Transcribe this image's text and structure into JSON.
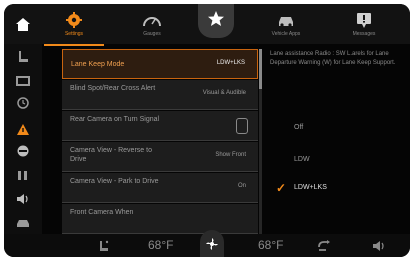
{
  "tabs": [
    {
      "label": "Settings",
      "icon": "gear-icon",
      "active": true
    },
    {
      "label": "Gauges",
      "icon": "gauge-icon",
      "active": false
    },
    {
      "label": "",
      "icon": "star-icon",
      "active": false
    },
    {
      "label": "Vehicle Apps",
      "icon": "car-icon",
      "active": false
    },
    {
      "label": "Messages",
      "icon": "message-icon",
      "active": false
    }
  ],
  "rail": [
    "seat-icon",
    "display-icon",
    "clock-icon",
    "warning-icon",
    "safety-icon",
    "seat-heat-icon",
    "audio-icon",
    "vehicle-icon"
  ],
  "settings": [
    {
      "title": "Lane Keep Mode",
      "value": "LDW+LKS",
      "selected": true
    },
    {
      "title": "Blind Spot/Rear Cross Alert",
      "value": "Visual & Audible",
      "selected": false
    },
    {
      "title": "Rear Camera on Turn Signal",
      "value": "",
      "selected": false,
      "toggle": true
    },
    {
      "title": "Camera View - Reverse to Drive",
      "value": "Show Front",
      "selected": false
    },
    {
      "title": "Camera View - Park to Drive",
      "value": "On",
      "selected": false
    },
    {
      "title": "Front Camera When",
      "value": "",
      "selected": false
    }
  ],
  "info_text": "Lane assistance Radio : SW L.arels for Lane Departure Warning (W) for Lane Keep Support.",
  "options": [
    {
      "label": "Off",
      "checked": false
    },
    {
      "label": "LDW",
      "checked": false
    },
    {
      "label": "LDW+LKS",
      "checked": true
    }
  ],
  "climate": {
    "left_temp": "68°F",
    "right_temp": "68°F"
  },
  "colors": {
    "accent": "#f28a1a",
    "background": "#050505"
  }
}
